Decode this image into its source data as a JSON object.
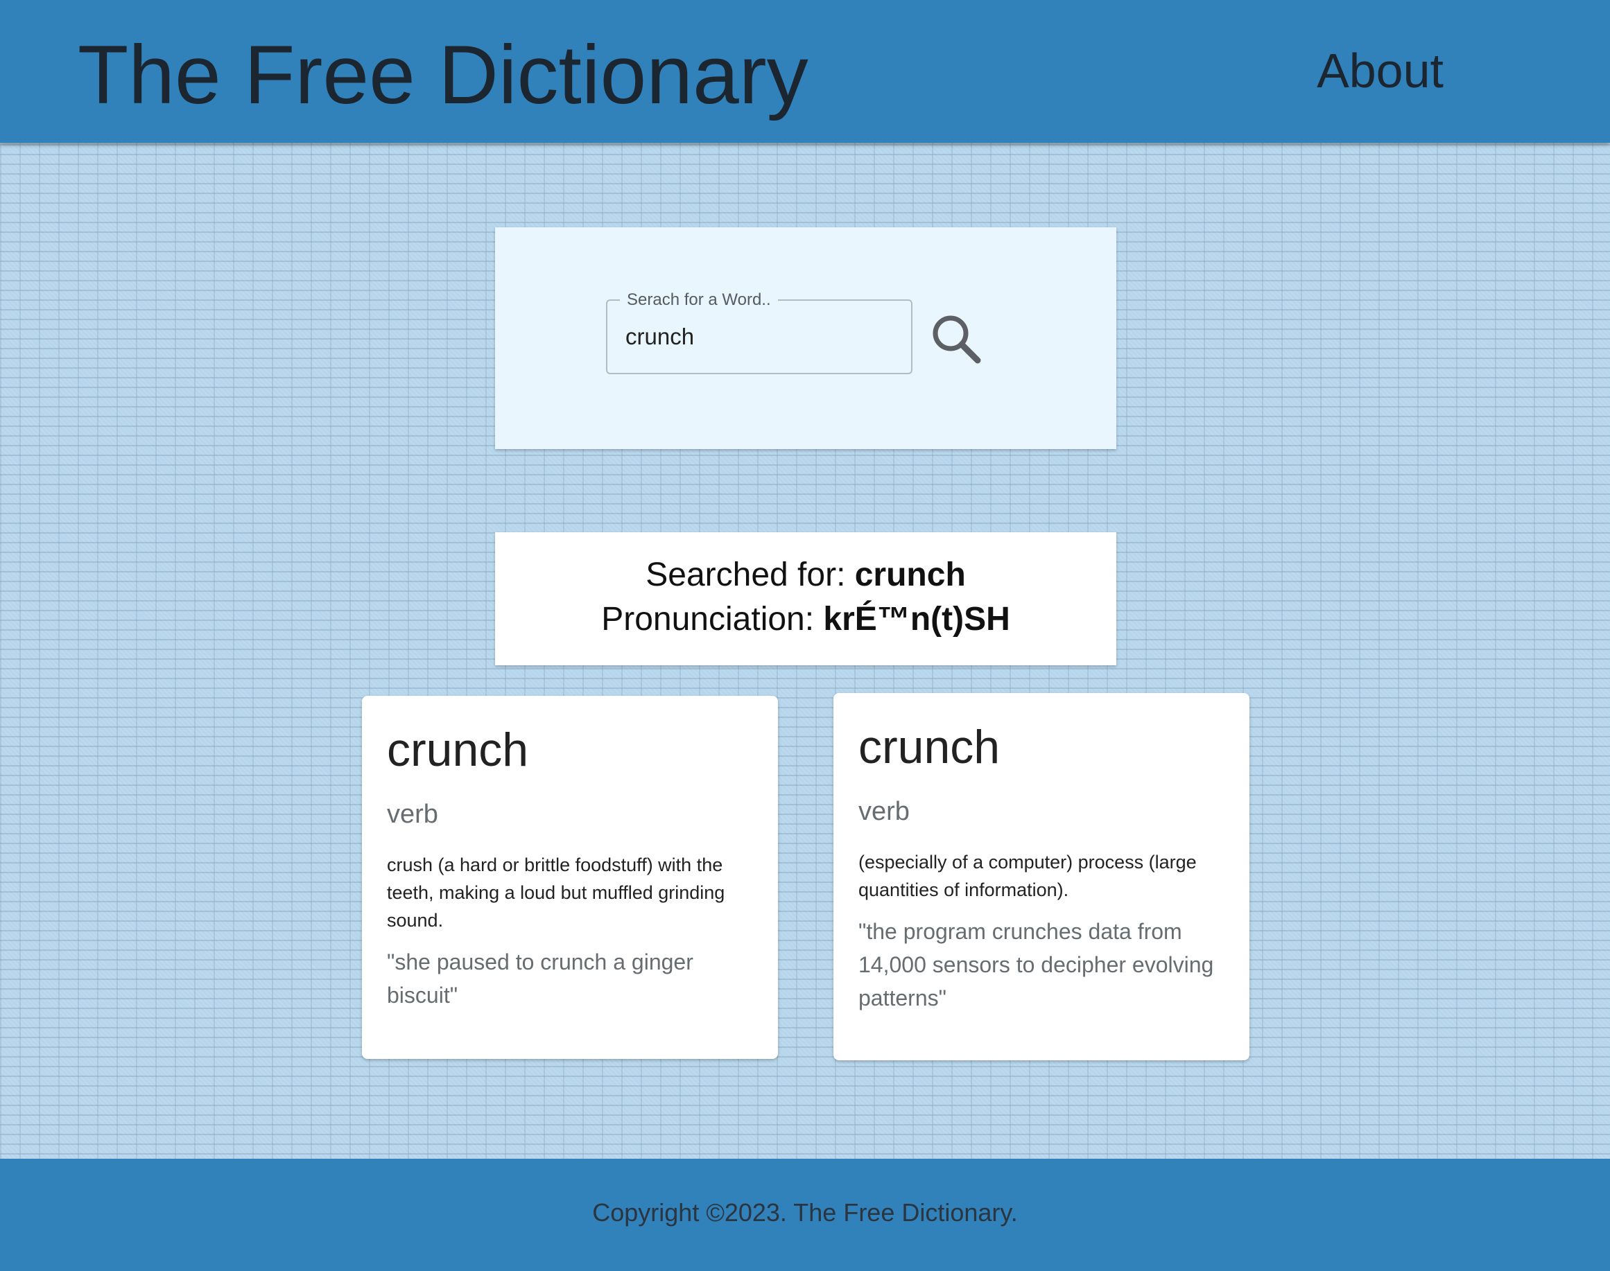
{
  "header": {
    "title": "The Free Dictionary",
    "about_label": "About"
  },
  "search": {
    "label": "Serach for a Word..",
    "value": "crunch",
    "button_icon": "search-icon"
  },
  "result": {
    "searched_prefix": "Searched for: ",
    "searched_word": "crunch",
    "pronunciation_prefix": "Pronunciation: ",
    "pronunciation": "krÉ™n(t)SH"
  },
  "definitions": [
    {
      "word": "crunch",
      "part_of_speech": "verb",
      "definition": "crush (a hard or brittle foodstuff) with the teeth, making a loud but muffled grinding sound.",
      "example": "\"she paused to crunch a ginger biscuit\""
    },
    {
      "word": "crunch",
      "part_of_speech": "verb",
      "definition": "(especially of a computer) process (large quantities of information).",
      "example": "\"the program crunches data from 14,000 sensors to decipher evolving patterns\""
    }
  ],
  "footer": {
    "copyright": "Copyright ©2023. The Free Dictionary."
  },
  "colors": {
    "header_footer": "#3181ba",
    "page_background": "#b7d6ec",
    "search_panel": "#e9f6fd",
    "card": "#ffffff",
    "muted_text": "#666c70"
  }
}
